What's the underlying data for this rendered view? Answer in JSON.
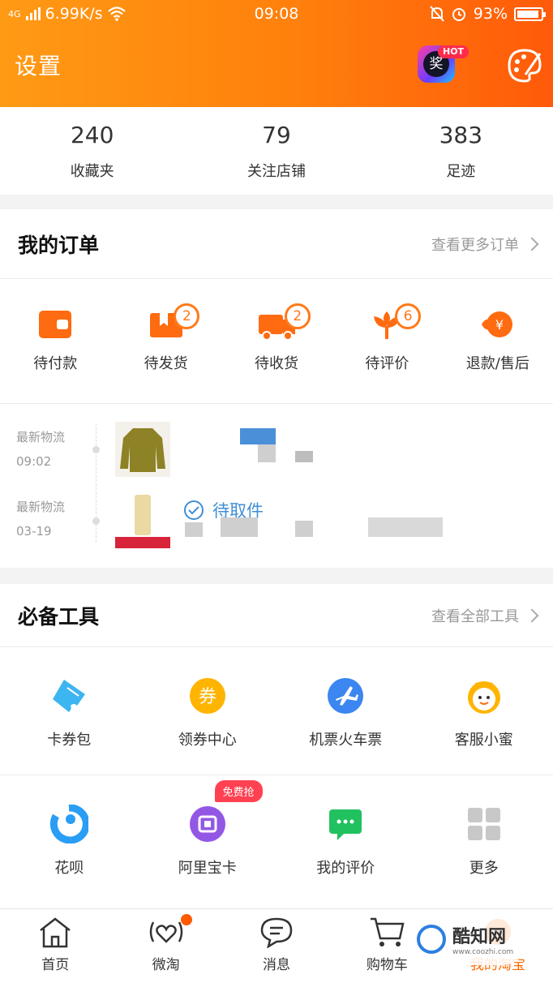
{
  "status": {
    "network": "4G",
    "speed": "6.99K/s",
    "time": "09:08",
    "battery": "93%"
  },
  "header": {
    "title": "设置",
    "prize_char": "奖",
    "hot_badge": "HOT"
  },
  "stats": [
    {
      "value": "240",
      "label": "收藏夹"
    },
    {
      "value": "79",
      "label": "关注店铺"
    },
    {
      "value": "383",
      "label": "足迹"
    }
  ],
  "orders": {
    "title": "我的订单",
    "more": "查看更多订单",
    "items": [
      {
        "label": "待付款",
        "badge": ""
      },
      {
        "label": "待发货",
        "badge": "2"
      },
      {
        "label": "待收货",
        "badge": "2"
      },
      {
        "label": "待评价",
        "badge": "6"
      },
      {
        "label": "退款/售后",
        "badge": ""
      }
    ],
    "logistics": [
      {
        "label": "最新物流",
        "time": "09:02"
      },
      {
        "label": "最新物流",
        "time": "03-19",
        "status": "待取件"
      }
    ]
  },
  "tools": {
    "title": "必备工具",
    "more": "查看全部工具",
    "row1": [
      "卡券包",
      "领券中心",
      "机票火车票",
      "客服小蜜"
    ],
    "row2": [
      "花呗",
      "阿里宝卡",
      "我的评价",
      "更多"
    ],
    "free_badge": "免费抢"
  },
  "tabbar": [
    "首页",
    "微淘",
    "消息",
    "购物车",
    "我的淘宝"
  ],
  "watermark": {
    "name": "酷知网",
    "url": "www.coozhi.com"
  },
  "colors": {
    "accent": "#ff7a1a",
    "link": "#3f8fd6"
  }
}
